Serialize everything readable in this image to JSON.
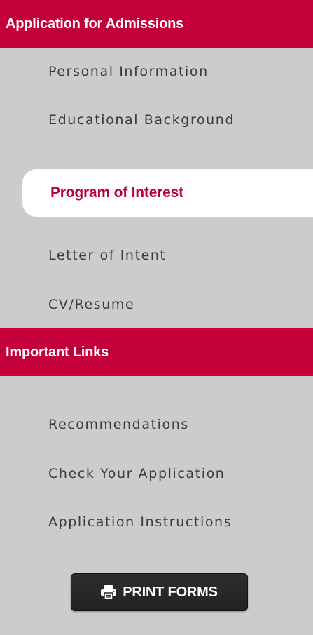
{
  "sidebar": {
    "application_section": {
      "title": "Application for Admissions",
      "items": [
        {
          "label": "Personal Information",
          "active": false
        },
        {
          "label": "Educational Background",
          "active": false
        },
        {
          "label": "Program of Interest",
          "active": true
        },
        {
          "label": "Letter of Intent",
          "active": false
        },
        {
          "label": "CV/Resume",
          "active": false
        }
      ]
    },
    "links_section": {
      "title": "Important Links",
      "items": [
        {
          "label": "Recommendations"
        },
        {
          "label": "Check Your Application"
        },
        {
          "label": "Application Instructions"
        }
      ]
    },
    "print_button": {
      "label": "PRINT FORMS",
      "icon": "printer-icon"
    }
  },
  "colors": {
    "accent": "#c4003a",
    "background": "#cccccc",
    "active_item_bg": "#ffffff",
    "active_item_text": "#b8003a",
    "item_text": "#3a3a3a",
    "button_bg": "#262626"
  }
}
